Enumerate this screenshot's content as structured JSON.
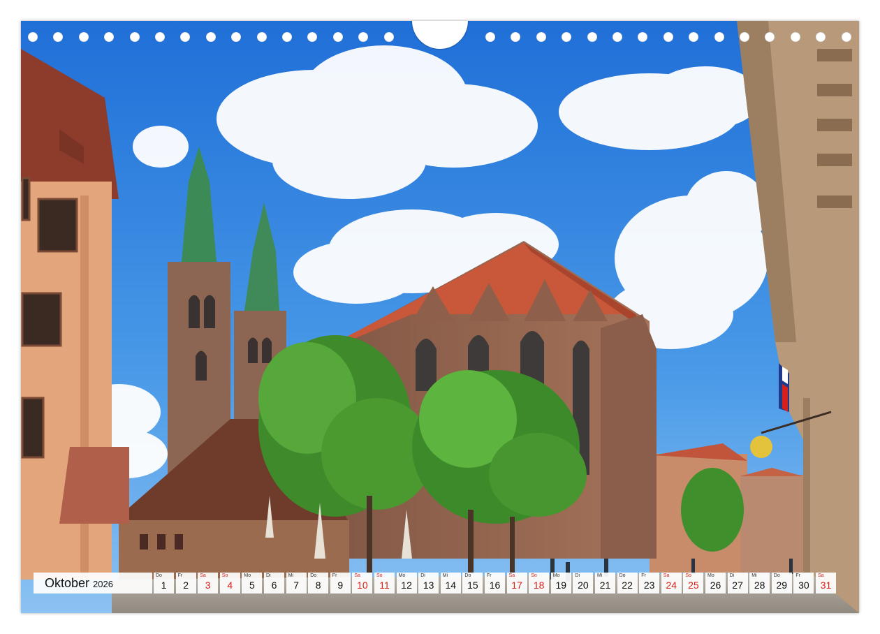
{
  "calendar": {
    "month": "Oktober",
    "year": "2026",
    "days": [
      {
        "wd": "Do",
        "num": "1",
        "weekend": false
      },
      {
        "wd": "Fr",
        "num": "2",
        "weekend": false
      },
      {
        "wd": "Sa",
        "num": "3",
        "weekend": true
      },
      {
        "wd": "So",
        "num": "4",
        "weekend": true
      },
      {
        "wd": "Mo",
        "num": "5",
        "weekend": false
      },
      {
        "wd": "Di",
        "num": "6",
        "weekend": false
      },
      {
        "wd": "Mi",
        "num": "7",
        "weekend": false
      },
      {
        "wd": "Do",
        "num": "8",
        "weekend": false
      },
      {
        "wd": "Fr",
        "num": "9",
        "weekend": false
      },
      {
        "wd": "Sa",
        "num": "10",
        "weekend": true
      },
      {
        "wd": "So",
        "num": "11",
        "weekend": true
      },
      {
        "wd": "Mo",
        "num": "12",
        "weekend": false
      },
      {
        "wd": "Di",
        "num": "13",
        "weekend": false
      },
      {
        "wd": "Mi",
        "num": "14",
        "weekend": false
      },
      {
        "wd": "Do",
        "num": "15",
        "weekend": false
      },
      {
        "wd": "Fr",
        "num": "16",
        "weekend": false
      },
      {
        "wd": "Sa",
        "num": "17",
        "weekend": true
      },
      {
        "wd": "So",
        "num": "18",
        "weekend": true
      },
      {
        "wd": "Mo",
        "num": "19",
        "weekend": false
      },
      {
        "wd": "Di",
        "num": "20",
        "weekend": false
      },
      {
        "wd": "Mi",
        "num": "21",
        "weekend": false
      },
      {
        "wd": "Do",
        "num": "22",
        "weekend": false
      },
      {
        "wd": "Fr",
        "num": "23",
        "weekend": false
      },
      {
        "wd": "Sa",
        "num": "24",
        "weekend": true
      },
      {
        "wd": "So",
        "num": "25",
        "weekend": true
      },
      {
        "wd": "Mo",
        "num": "26",
        "weekend": false
      },
      {
        "wd": "Di",
        "num": "27",
        "weekend": false
      },
      {
        "wd": "Mi",
        "num": "28",
        "weekend": false
      },
      {
        "wd": "Do",
        "num": "29",
        "weekend": false
      },
      {
        "wd": "Fr",
        "num": "30",
        "weekend": false
      },
      {
        "wd": "Sa",
        "num": "31",
        "weekend": true
      }
    ]
  },
  "colors": {
    "weekend": "#d8201a",
    "sky": "#3f8fe0",
    "brick_roof": "#c5583a",
    "sandstone": "#a46b4e"
  }
}
